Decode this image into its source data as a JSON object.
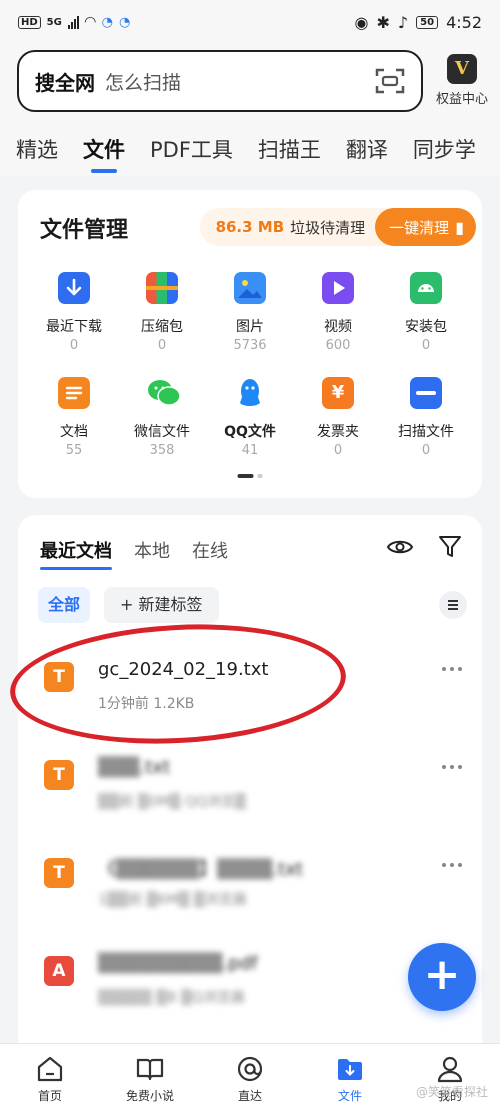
{
  "status_bar": {
    "network": "HD",
    "signal": "5G",
    "battery": "50",
    "time": "4:52"
  },
  "search": {
    "keyword": "搜全网",
    "placeholder": "怎么扫描"
  },
  "vip": {
    "badge": "V",
    "label": "权益中心"
  },
  "tabs": [
    {
      "label": "精选",
      "active": false
    },
    {
      "label": "文件",
      "active": true
    },
    {
      "label": "PDF工具",
      "active": false
    },
    {
      "label": "扫描王",
      "active": false
    },
    {
      "label": "翻译",
      "active": false
    },
    {
      "label": "同步学",
      "active": false
    }
  ],
  "file_manager": {
    "title": "文件管理",
    "junk_size": "86.3 MB",
    "junk_label": "垃圾待清理",
    "clean_button": "一键清理",
    "categories": [
      {
        "label": "最近下载",
        "count": "0",
        "icon": "download-icon",
        "color": "#2f6df0"
      },
      {
        "label": "压缩包",
        "count": "0",
        "icon": "archive-icon",
        "color": "#ef5a3d"
      },
      {
        "label": "图片",
        "count": "5736",
        "icon": "image-icon",
        "color": "#3a8ff5"
      },
      {
        "label": "视频",
        "count": "600",
        "icon": "video-icon",
        "color": "#7b4df0"
      },
      {
        "label": "安装包",
        "count": "0",
        "icon": "android-icon",
        "color": "#2bbd6b"
      },
      {
        "label": "文档",
        "count": "55",
        "icon": "document-icon",
        "color": "#f5851f"
      },
      {
        "label": "微信文件",
        "count": "358",
        "icon": "wechat-icon",
        "color": "#2dc653"
      },
      {
        "label": "QQ文件",
        "count": "41",
        "icon": "qq-icon",
        "color": "#1e88f5"
      },
      {
        "label": "发票夹",
        "count": "0",
        "icon": "invoice-icon",
        "color": "#f57a21"
      },
      {
        "label": "扫描文件",
        "count": "0",
        "icon": "scan-file-icon",
        "color": "#2f6df0"
      }
    ]
  },
  "recent": {
    "tabs": [
      "最近文档",
      "本地",
      "在线"
    ],
    "chip_all": "全部",
    "chip_new": "+ 新建标签",
    "files": [
      {
        "name": "gc_2024_02_19.txt",
        "meta": "1分钟前  1.2KB",
        "icon_letter": "T",
        "color": "#f5851f",
        "blurred": false
      },
      {
        "name": "▒▒▒.txt",
        "meta": "▒▒前  ▒0M▒  QQ浏览▒",
        "icon_letter": "T",
        "color": "#f5851f",
        "blurred": true
      },
      {
        "name": "《▒▒▒▒▒▒】▒▒▒▒.txt",
        "meta": "1▒▒前  ▒6M▒  ▒浏览器",
        "icon_letter": "T",
        "color": "#f5851f",
        "blurred": true
      },
      {
        "name": "▒▒▒▒▒▒▒▒▒.pdf",
        "meta": "▒▒▒▒▒  ▒B  ▒Q浏览器",
        "icon_letter": "A",
        "color": "#e84a3c",
        "blurred": true
      }
    ]
  },
  "fab": "+",
  "bottom_nav": [
    {
      "label": "首页",
      "icon": "home-icon",
      "active": false
    },
    {
      "label": "免费小说",
      "icon": "book-icon",
      "active": false
    },
    {
      "label": "直达",
      "icon": "at-icon",
      "active": false
    },
    {
      "label": "文件",
      "icon": "file-icon",
      "active": true
    },
    {
      "label": "我的",
      "icon": "profile-icon",
      "active": false
    }
  ],
  "watermark": "@笑笑看探社"
}
